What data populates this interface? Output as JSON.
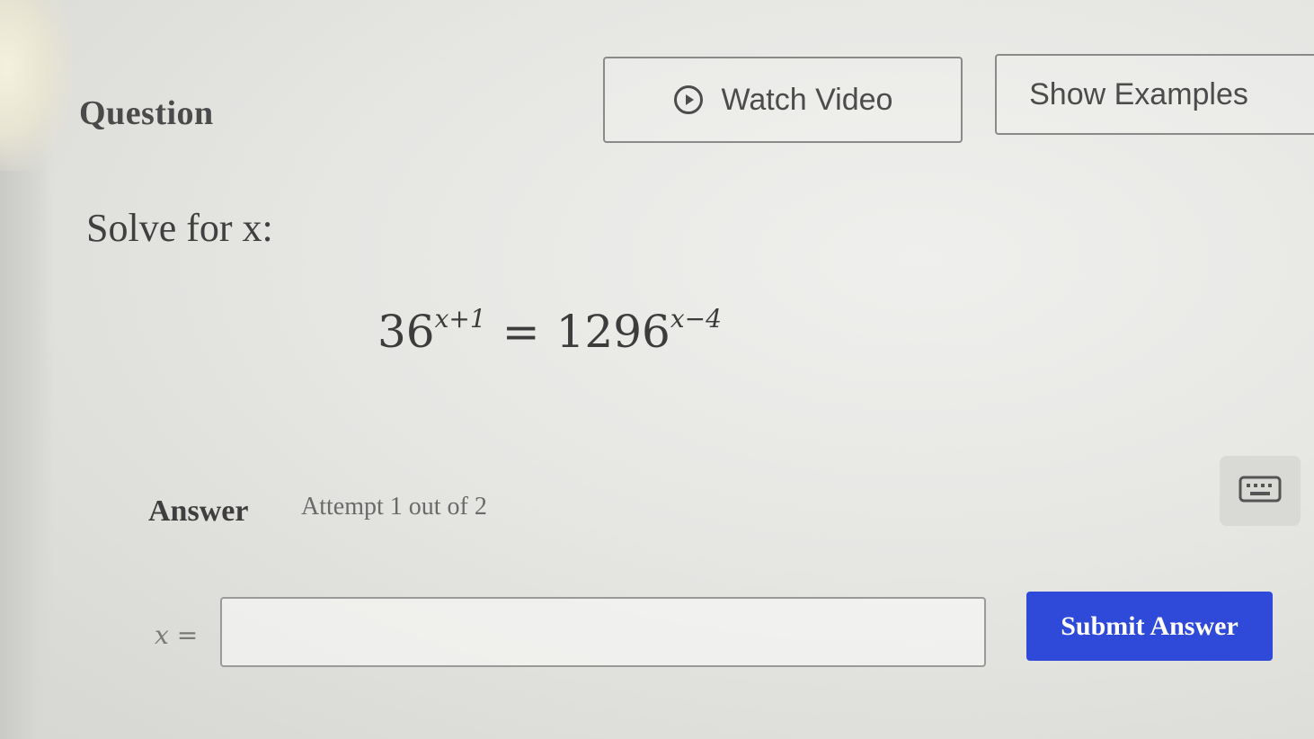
{
  "header": {
    "question_label": "Question",
    "watch_video_label": "Watch Video",
    "show_examples_label": "Show Examples"
  },
  "problem": {
    "instruction": "Solve for x:",
    "equation": {
      "left_base": "36",
      "left_exponent": "x+1",
      "equals": "=",
      "right_base": "1296",
      "right_exponent": "x−4"
    }
  },
  "answer": {
    "label": "Answer",
    "attempt_text": "Attempt 1 out of 2",
    "variable_label": "x =",
    "input_value": "",
    "submit_label": "Submit Answer"
  },
  "icons": {
    "play": "play-circle-icon",
    "keyboard": "keyboard-icon"
  },
  "colors": {
    "submit_button": "#2f49d8",
    "background": "#e6e6e3"
  }
}
